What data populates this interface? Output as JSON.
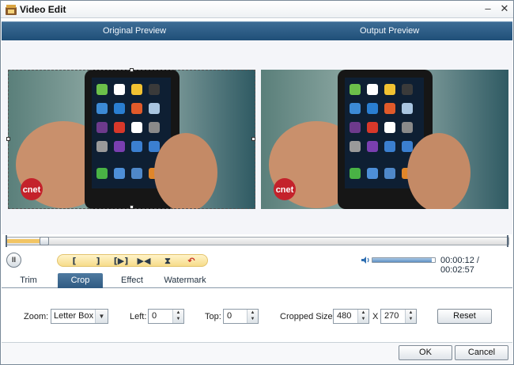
{
  "window": {
    "title": "Video Edit",
    "minimize_label": "–",
    "close_label": "✕"
  },
  "preview": {
    "original_label": "Original Preview",
    "output_label": "Output Preview",
    "watermark_text": "cnet"
  },
  "timeline": {
    "progress_fraction": 0.07,
    "volume_fraction": 0.95
  },
  "transport": {
    "pause_symbol": "II",
    "tools": [
      {
        "name": "set-start-icon",
        "symbol": "["
      },
      {
        "name": "set-end-icon",
        "symbol": "]"
      },
      {
        "name": "play-segment-icon",
        "symbol": "[▶]"
      },
      {
        "name": "jump-start-icon",
        "symbol": "▶◀"
      },
      {
        "name": "split-icon",
        "symbol": "⧗"
      },
      {
        "name": "undo-icon",
        "symbol": "↶"
      }
    ],
    "current_time": "00:00:12",
    "total_time": "00:02:57",
    "time_separator": " / "
  },
  "tabs": [
    {
      "label": "Trim",
      "active": false
    },
    {
      "label": "Crop",
      "active": true
    },
    {
      "label": "Effect",
      "active": false
    },
    {
      "label": "Watermark",
      "active": false
    }
  ],
  "crop": {
    "zoom_label": "Zoom:",
    "zoom_value": "Letter Box",
    "left_label": "Left:",
    "left_value": "0",
    "top_label": "Top:",
    "top_value": "0",
    "cropped_size_label": "Cropped Size:",
    "width_value": "480",
    "size_separator": "X",
    "height_value": "270",
    "reset_label": "Reset"
  },
  "footer": {
    "ok_label": "OK",
    "cancel_label": "Cancel"
  },
  "colors": {
    "header_blue": "#2f5a82",
    "tab_active": "#3f6990",
    "timeline_fill": "#f2c564",
    "tool_strip": "#f6dc8a"
  }
}
